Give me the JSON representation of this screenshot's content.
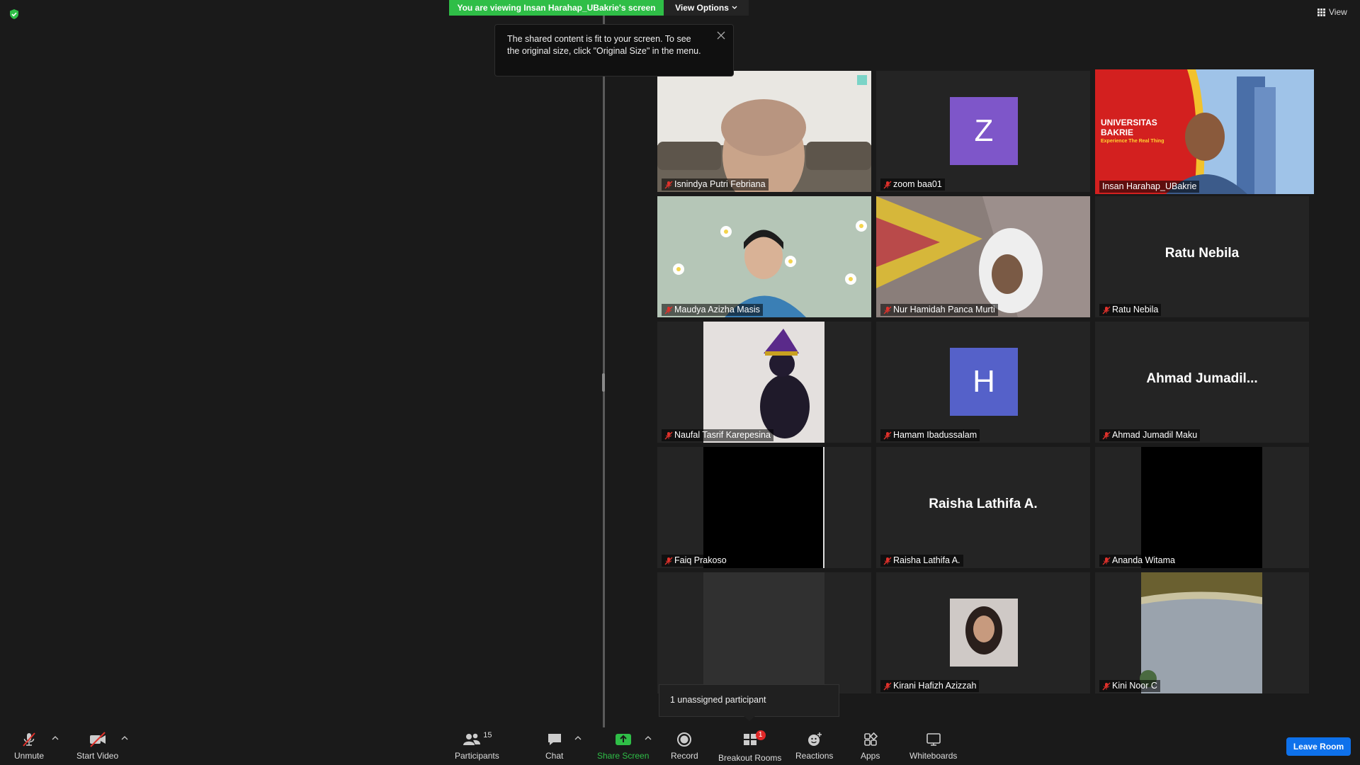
{
  "banner": {
    "viewing_text": "You are viewing Insan Harahap_UBakrie's screen",
    "view_options_label": "View Options"
  },
  "top_right": {
    "view_label": "View"
  },
  "tooltip": {
    "text": "The shared content is fit to your screen. To see the original size, click \"Original Size\" in the menu."
  },
  "tiles": [
    {
      "name": "Isnindya Putri Febriana",
      "display": "video"
    },
    {
      "name": "zoom baa01",
      "display": "avatar",
      "initial": "Z",
      "avatar_color": "#7e56c9"
    },
    {
      "name": "Insan Harahap_UBakrie",
      "display": "video",
      "active_speaker": true,
      "slide_title_1": "UNIVERSITAS",
      "slide_title_2": "BAKRIE",
      "slide_tagline": "Experience The Real Thing"
    },
    {
      "name": "Maudya Azizha Masis",
      "display": "video"
    },
    {
      "name": "Nur Hamidah Panca Murti",
      "display": "video"
    },
    {
      "name": "Ratu Nebila",
      "display": "name",
      "big_name": "Ratu Nebila"
    },
    {
      "name": "Naufal Tasrif Karepesina",
      "display": "video"
    },
    {
      "name": "Hamam Ibadussalam",
      "display": "avatar",
      "initial": "H",
      "avatar_color": "#5561c9"
    },
    {
      "name": "Ahmad Jumadil Maku",
      "display": "name",
      "big_name": "Ahmad  Jumadil..."
    },
    {
      "name": "Faiq Prakoso",
      "display": "video"
    },
    {
      "name": "Raisha Lathifa A.",
      "display": "name",
      "big_name": "Raisha Lathifa A."
    },
    {
      "name": "Ananda Witama",
      "display": "video"
    },
    {
      "name": "",
      "display": "video"
    },
    {
      "name": "Kirani Hafizh Azizzah",
      "display": "video"
    },
    {
      "name": "Kini Noor C",
      "display": "video"
    }
  ],
  "unassigned_popup": {
    "text": "1 unassigned participant"
  },
  "toolbar": {
    "unmute": "Unmute",
    "start_video": "Start Video",
    "participants": "Participants",
    "participants_count": "15",
    "chat": "Chat",
    "share_screen": "Share Screen",
    "record": "Record",
    "breakout_rooms": "Breakout Rooms",
    "breakout_badge": "1",
    "reactions": "Reactions",
    "apps": "Apps",
    "whiteboards": "Whiteboards",
    "leave_room": "Leave Room"
  },
  "colors": {
    "share_green": "#2fbe47",
    "leave_blue": "#0e71eb",
    "speaker_yellow": "#ffd430",
    "badge_red": "#e02828"
  }
}
